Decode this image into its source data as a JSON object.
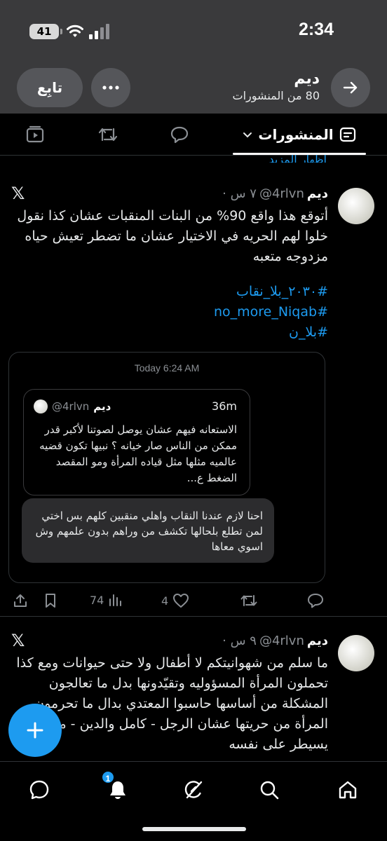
{
  "status_bar": {
    "time": "2:34",
    "battery": "41"
  },
  "header": {
    "name": "ديم",
    "posts_count": "80 من المنشورات",
    "follow_label": "تابِع"
  },
  "tabs": {
    "posts_label": "المنشورات"
  },
  "peek_link": "إظهار المزيد",
  "post1": {
    "name": "ديم",
    "handle": "@4rlvn",
    "time": "٧ س",
    "text": "أتوقع هذا واقع 90% من البنات المنقبات عشان كذا نقول خلوا لهم الحريه في الاختيار عشان ما تضطر تعيش حياه مزدوجه متعبه",
    "hashtags": [
      "#٢٠٣٠_بلا_نقاب",
      "#no_more_Niqab",
      "#بلا_ن"
    ],
    "card": {
      "timestamp": "Today 6:24 AM",
      "quote": {
        "name": "ديم",
        "handle": "@4rlvn",
        "age": "36m",
        "text": "الاستعانه فيهم عشان يوصل لصوتنا لأكبر قدر ممكن من الناس صار خيانه ؟ نبيها تكون قضيه عالميه مثلها مثل قياده المرأة ومو المقصد الضغط ع..."
      },
      "reply": "احنا لازم عندنا النقاب واهلي منقبين كلهم بس اختي لمن تطلع بلحالها تكشف من وراهم بدون علمهم وش اسوي معاها"
    },
    "stats": {
      "views": "74",
      "likes": "4"
    }
  },
  "post2": {
    "name": "ديم",
    "handle": "@4rlvn",
    "time": "٩ س",
    "text": "ما سلم من شهوانيتكم لا أطفال ولا حتى حيوانات ومع كذا تحملون المرأة المسؤوليه وتقيّدونها بدل ما تعالجون المشكلة من أساسها حاسبوا المعتدي بدال ما تحرمون المرأة من حريتها عشان الرجل - كامل والدين - مو قادر يسيطر على نفسه"
  },
  "bottom_nav": {
    "notifications_badge": "1"
  },
  "colors": {
    "accent": "#1d9bf0",
    "background": "#000000",
    "header_bg": "#3a3a3c",
    "muted": "#8b8f94"
  },
  "icons": {
    "status": [
      "battery-icon",
      "wifi-icon",
      "signal-icon"
    ],
    "header": [
      "more-icon",
      "back-arrow-icon"
    ],
    "tabs": [
      "posts-tab-icon",
      "replies-icon",
      "retweets-icon",
      "media-icon",
      "chevron-down-icon"
    ],
    "actions": [
      "share-icon",
      "bookmark-icon",
      "views-icon",
      "like-icon",
      "retweet-icon",
      "reply-icon"
    ],
    "nav": [
      "messages-icon",
      "notifications-icon",
      "grok-icon",
      "search-icon",
      "home-icon"
    ]
  }
}
